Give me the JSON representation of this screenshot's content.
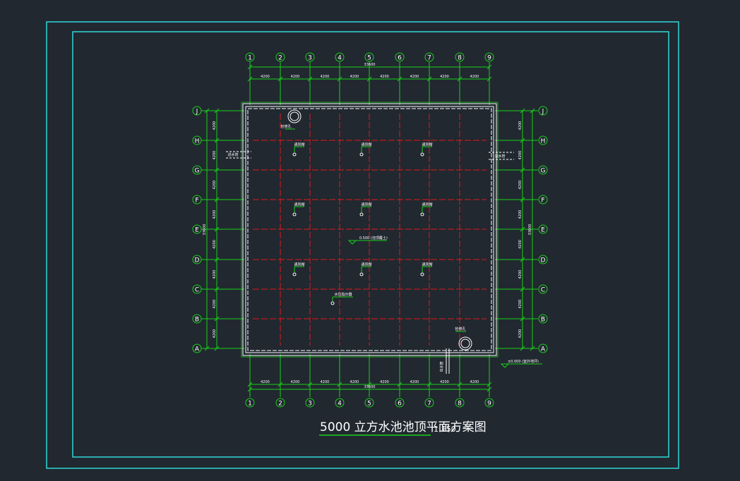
{
  "drawing": {
    "title": "5000 立方水池池顶平面方案图",
    "scale": "1:150",
    "colors": {
      "background": "#212830",
      "frame": "#2fd8d8",
      "grid_green": "#19d119",
      "grid_red": "#e01818",
      "outline_white": "#ffffff",
      "text_white": "#ffffff"
    },
    "column_axes": [
      "1",
      "2",
      "3",
      "4",
      "5",
      "6",
      "7",
      "8",
      "9"
    ],
    "row_axes_top_to_bottom": [
      "J",
      "H",
      "G",
      "F",
      "E",
      "D",
      "C",
      "B",
      "A"
    ],
    "column_spacings": [
      "4200",
      "4200",
      "4200",
      "4200",
      "4200",
      "4200",
      "4200",
      "4200"
    ],
    "row_spacings": [
      "4200",
      "4200",
      "4200",
      "4200",
      "4200",
      "4200",
      "4200",
      "4200"
    ],
    "overall_width": "33600",
    "overall_height": "33600",
    "labels": {
      "manhole_tl": "检修孔",
      "manhole_br": "检修孔",
      "pipe_left": "进水管",
      "pipe_right": "溢水管",
      "pipe_bottom": "出水管",
      "vent": "通风帽",
      "center_level": "0.500 (池顶覆土)",
      "bottom_level": "±0.000 (室外地坪)",
      "gauge": "水位指示器"
    }
  }
}
